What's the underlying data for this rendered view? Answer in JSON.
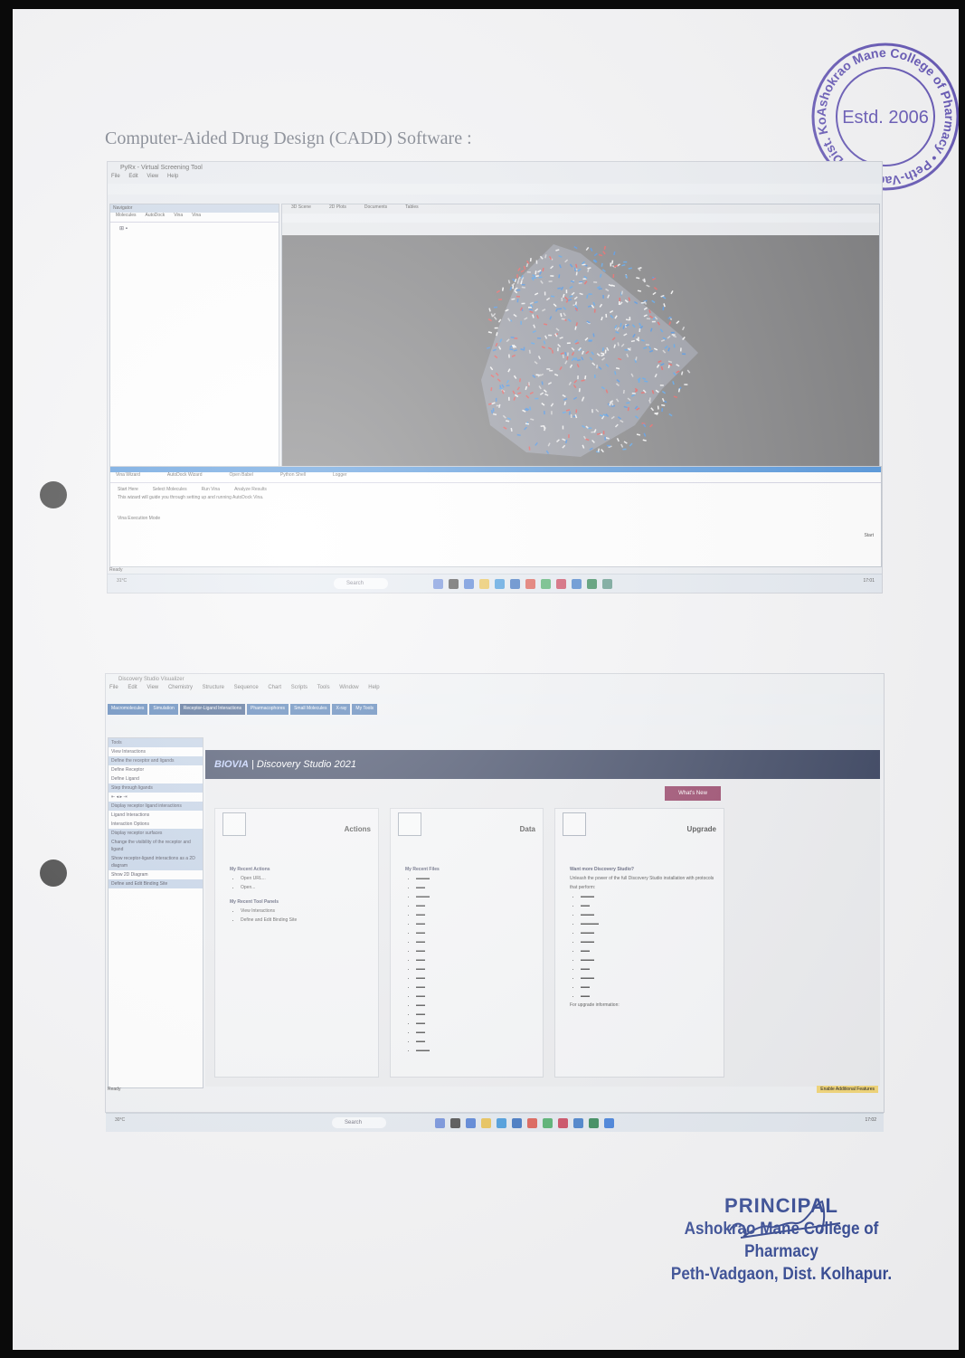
{
  "page": {
    "heading": "Computer-Aided Drug Design (CADD) Software :"
  },
  "seal": {
    "ring_text": "Ashokrao Mane College of Pharmacy • Peth-Vadgaon, Dist. Kolhapur",
    "center_text": "Estd. 2006",
    "color": "#5a4bb0"
  },
  "signature_block": {
    "title": "PRINCIPAL",
    "line1": "Ashokrao Mane College of Pharmacy",
    "line2": "Peth-Vadgaon, Dist. Kolhapur.",
    "color": "#2c4290"
  },
  "screenshot1": {
    "window_title": "PyRx - Virtual Screening Tool",
    "menu": [
      "File",
      "Edit",
      "View",
      "Help"
    ],
    "navigator_header": "Navigator",
    "nav_tabs": [
      "Molecules",
      "AutoDock",
      "Vina",
      "Vina"
    ],
    "viewer_tabs": [
      "3D Scene",
      "2D Plots",
      "Documents",
      "Tables"
    ],
    "panel_tabs": [
      "Vina Wizard",
      "AutoDock Wizard",
      "Open Babel",
      "Python Shell",
      "Logger"
    ],
    "panel_buttons": [
      "Start Here",
      "Select Molecules",
      "Run Vina",
      "Analyze Results"
    ],
    "panel_text": "This wizard will guide you through setting up and running AutoDock Vina.",
    "exec_mode_label": "Vina Execution Mode",
    "start_label": "Start",
    "status": "Ready",
    "taskbar": {
      "search": "Search",
      "weather": "31°C",
      "time": "17:01"
    }
  },
  "screenshot2": {
    "window_title": "Discovery Studio Visualizer",
    "menu": [
      "File",
      "Edit",
      "View",
      "Chemistry",
      "Structure",
      "Sequence",
      "Chart",
      "Scripts",
      "Tools",
      "Window",
      "Help"
    ],
    "ribbon_tabs": [
      "Macromolecules",
      "Simulation",
      "Receptor-Ligand Interactions",
      "Pharmacophores",
      "Small Molecules",
      "X-ray",
      "My Tools"
    ],
    "active_ribbon": "Receptor-Ligand Interactions",
    "left_panel": [
      "Tools",
      "View Interactions",
      "Define the receptor and ligands",
      "Define Receptor",
      "Define Ligand",
      "Step through ligands",
      "Display receptor ligand interactions",
      "Ligand Interactions",
      "Interaction Options",
      "Display receptor surfaces",
      "Change the visibility of the receptor and ligand",
      "Show receptor-ligand interactions as a 2D diagram",
      "Show 2D Diagram",
      "Define and Edit Binding Site"
    ],
    "banner_brand": "BIOVIA",
    "banner_title": "Discovery Studio 2021",
    "whats_new": "What's New",
    "cards": {
      "actions": {
        "title": "Actions",
        "recent_actions_label": "My Recent Actions",
        "recent_actions": [
          "Open URL...",
          "Open..."
        ],
        "recent_tools_label": "My Recent Tool Panels",
        "recent_tools": [
          "View Interactions",
          "Define and Edit Binding Site"
        ]
      },
      "data": {
        "title": "Data",
        "recent_files_label": "My Recent Files"
      },
      "upgrade": {
        "title": "Upgrade",
        "want_more": "Want more Discovery Studio?",
        "intro": "Unleash the power of the full Discovery Studio installation with protocols that perform:",
        "more_info": "For upgrade information:"
      }
    },
    "footer": "Ready",
    "footer_pill": "Enable Additional Features",
    "taskbar": {
      "search": "Search",
      "weather": "30°C",
      "time": "17:02"
    }
  }
}
